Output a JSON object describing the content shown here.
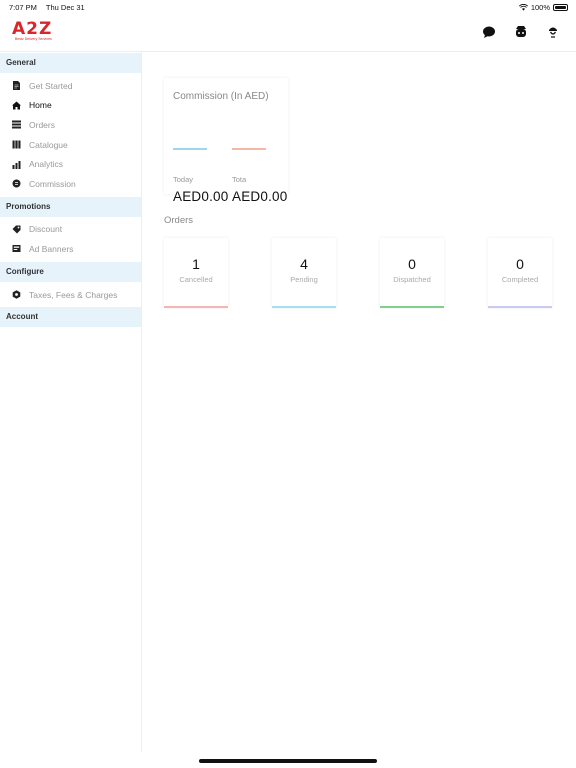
{
  "status": {
    "time": "7:07 PM",
    "date": "Thu Dec 31",
    "battery": "100%"
  },
  "brand": {
    "mark": "A2Z",
    "tagline": "Bestz Delivery Services"
  },
  "sidebar": {
    "sections": [
      {
        "title": "General",
        "items": [
          {
            "label": "Get Started",
            "icon": "document-icon"
          },
          {
            "label": "Home",
            "icon": "home-icon",
            "active": true
          },
          {
            "label": "Orders",
            "icon": "list-icon"
          },
          {
            "label": "Catalogue",
            "icon": "book-icon"
          },
          {
            "label": "Analytics",
            "icon": "chart-icon"
          },
          {
            "label": "Commission",
            "icon": "coin-icon"
          }
        ]
      },
      {
        "title": "Promotions",
        "items": [
          {
            "label": "Discount",
            "icon": "tag-icon"
          },
          {
            "label": "Ad Banners",
            "icon": "banner-icon"
          }
        ]
      },
      {
        "title": "Configure",
        "items": [
          {
            "label": "Taxes, Fees & Charges",
            "icon": "settings-icon"
          }
        ]
      },
      {
        "title": "Account",
        "items": []
      }
    ]
  },
  "commission": {
    "title": "Commission (In AED)",
    "today_label": "Today",
    "total_label": "Tota",
    "today_value": "AED0.00",
    "total_value": "AED0.00",
    "colors": {
      "today": "#9ed7ec",
      "total": "#f3b8a6"
    }
  },
  "orders": {
    "title": "Orders",
    "cards": [
      {
        "count": "1",
        "label": "Cancelled",
        "color": "#f5b5b5"
      },
      {
        "count": "4",
        "label": "Pending",
        "color": "#a8dff0"
      },
      {
        "count": "0",
        "label": "Dispatched",
        "color": "#7fd08a"
      },
      {
        "count": "0",
        "label": "Completed",
        "color": "#c9c9f5"
      }
    ]
  }
}
